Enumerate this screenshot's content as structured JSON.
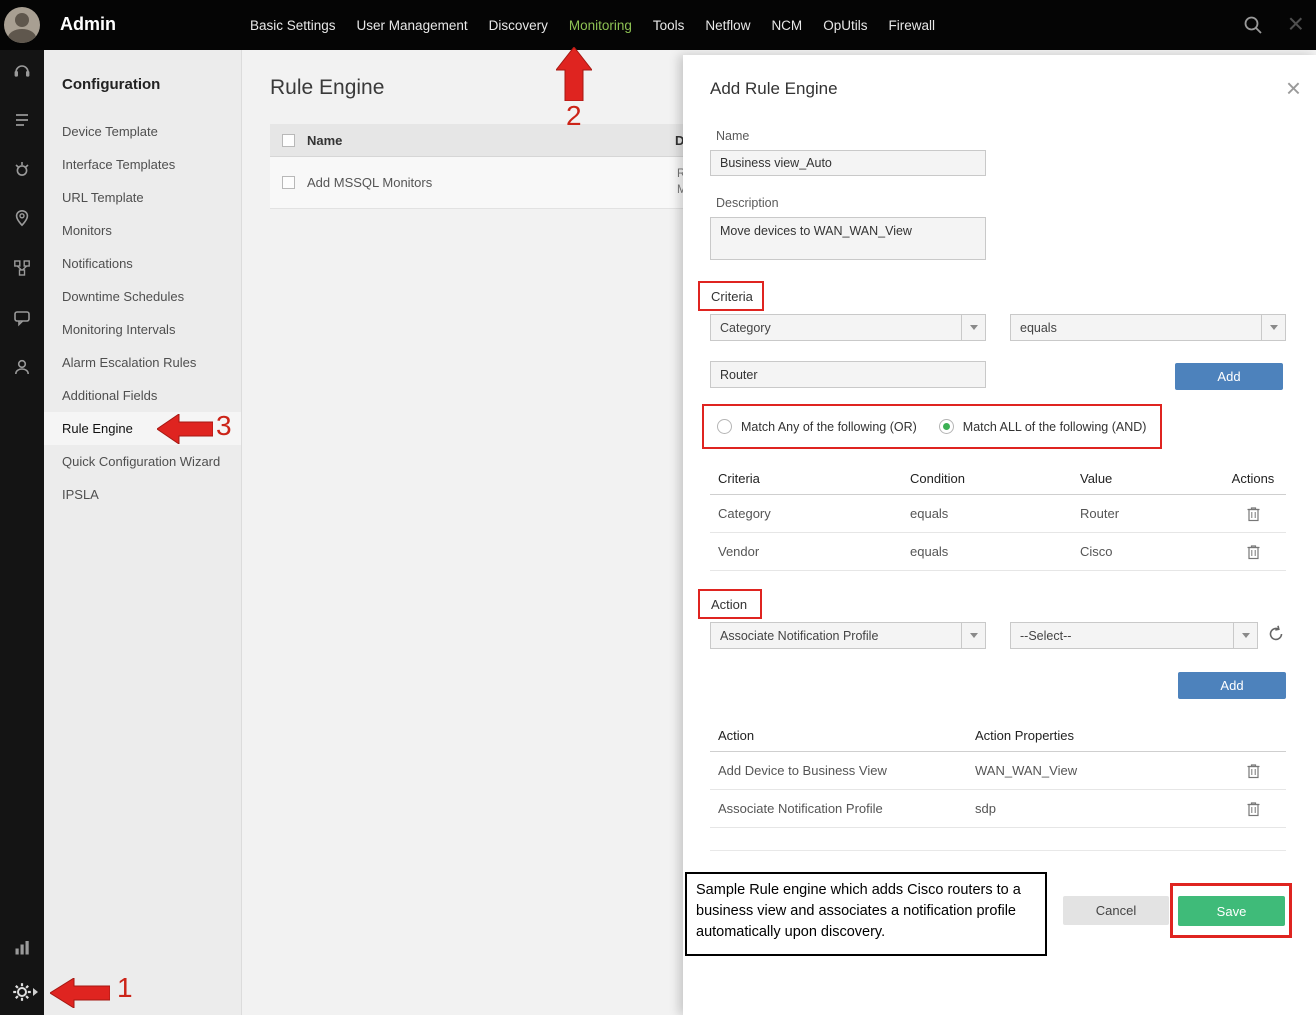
{
  "topbar": {
    "title": "Admin",
    "nav": [
      {
        "label": "Basic Settings"
      },
      {
        "label": "User Management"
      },
      {
        "label": "Discovery"
      },
      {
        "label": "Monitoring"
      },
      {
        "label": "Tools"
      },
      {
        "label": "Netflow"
      },
      {
        "label": "NCM"
      },
      {
        "label": "OpUtils"
      },
      {
        "label": "Firewall"
      }
    ],
    "close_glyph": "×"
  },
  "sidebar": {
    "title": "Configuration",
    "items": [
      {
        "label": "Device Template"
      },
      {
        "label": "Interface Templates"
      },
      {
        "label": "URL Template"
      },
      {
        "label": "Monitors"
      },
      {
        "label": "Notifications"
      },
      {
        "label": "Downtime Schedules"
      },
      {
        "label": "Monitoring Intervals"
      },
      {
        "label": "Alarm Escalation Rules"
      },
      {
        "label": "Additional Fields"
      },
      {
        "label": "Rule Engine"
      },
      {
        "label": "Quick Configuration Wizard"
      },
      {
        "label": "IPSLA"
      }
    ]
  },
  "main": {
    "title": "Rule Engine",
    "table": {
      "name_header": "Name",
      "desc_header_fragment": "D",
      "rows": [
        {
          "name": "Add MSSQL Monitors",
          "desc_fragment_1": "R",
          "desc_fragment_2": "M"
        }
      ]
    }
  },
  "panel": {
    "title": "Add Rule Engine",
    "close_glyph": "×",
    "name_label": "Name",
    "name_value": "Business view_Auto",
    "description_label": "Description",
    "description_value": "Move devices to WAN_WAN_View",
    "criteria": {
      "section_label": "Criteria",
      "field_dropdown_value": "Category",
      "condition_dropdown_value": "equals",
      "value_input": "Router",
      "add_button": "Add",
      "match_any_label": "Match Any of the following (OR)",
      "match_all_label": "Match ALL of the following (AND)",
      "table": {
        "headers": [
          "Criteria",
          "Condition",
          "Value",
          "Actions"
        ],
        "rows": [
          {
            "criteria": "Category",
            "condition": "equals",
            "value": "Router"
          },
          {
            "criteria": "Vendor",
            "condition": "equals",
            "value": "Cisco"
          }
        ]
      }
    },
    "action": {
      "section_label": "Action",
      "action_dropdown_value": "Associate Notification Profile",
      "select_dropdown_value": "--Select--",
      "add_button": "Add",
      "table": {
        "headers": [
          "Action",
          "Action Properties"
        ],
        "rows": [
          {
            "action": "Add Device to Business View",
            "property": "WAN_WAN_View"
          },
          {
            "action": "Associate Notification Profile",
            "property": "sdp"
          }
        ]
      }
    },
    "cancel_button": "Cancel",
    "save_button": "Save"
  },
  "annotations": {
    "step1": "1",
    "step2": "2",
    "step3": "3",
    "note": "Sample Rule engine which adds Cisco routers to a business view and associates a notification profile automatically upon discovery."
  },
  "colors": {
    "nav_active_green": "#8dc153",
    "add_button_blue": "#4d82bc",
    "save_button_green": "#3fbb79",
    "annotation_red": "#df2420"
  }
}
